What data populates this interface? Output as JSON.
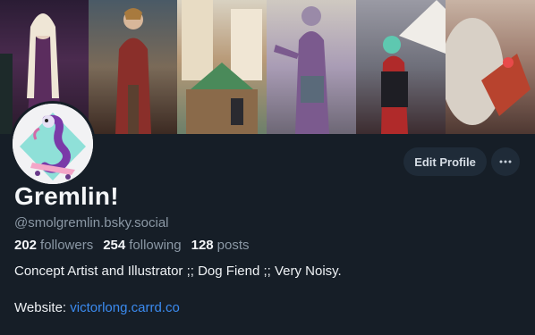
{
  "profile": {
    "display_name": "Gremlin!",
    "handle": "@smolgremlin.bsky.social",
    "bio": "Concept Artist and Illustrator ;; Dog Fiend ;; Very Noisy.",
    "website_label": "Website:",
    "website_link": "victorlong.carrd.co"
  },
  "stats": {
    "followers_count": "202",
    "followers_label": "followers",
    "following_count": "254",
    "following_label": "following",
    "posts_count": "128",
    "posts_label": "posts"
  },
  "actions": {
    "edit_profile_label": "Edit Profile",
    "more_icon": "ellipsis-icon"
  },
  "colors": {
    "background": "#161e27",
    "button_bg": "#1f2b38",
    "link": "#3b8bf0",
    "muted_text": "#8b98a5"
  }
}
